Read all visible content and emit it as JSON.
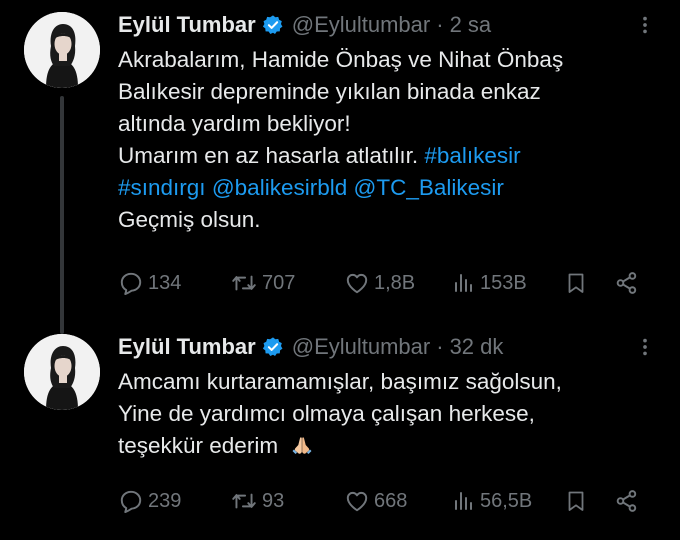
{
  "tweets": [
    {
      "author": {
        "name": "Eylül Tumbar",
        "handle": "@Eylultumbar",
        "verified": true
      },
      "separator": "·",
      "time": "2 sa",
      "text_lines": [
        [
          {
            "text": "Akrabalarım, Hamide Önbaş ve Nihat Önbaş",
            "link": false
          }
        ],
        [
          {
            "text": "Balıkesir depreminde yıkılan binada enkaz",
            "link": false
          }
        ],
        [
          {
            "text": "altında yardım bekliyor!",
            "link": false
          }
        ],
        [
          {
            "text": "Umarım en az hasarla atlatılır. ",
            "link": false
          },
          {
            "text": "#balıkesir",
            "link": true
          }
        ],
        [
          {
            "text": "#sındırgı",
            "link": true
          },
          {
            "text": " ",
            "link": false
          },
          {
            "text": "@balikesirbld",
            "link": true
          },
          {
            "text": " ",
            "link": false
          },
          {
            "text": "@TC_Balikesir",
            "link": true
          }
        ],
        [
          {
            "text": "Geçmiş olsun.",
            "link": false
          }
        ]
      ],
      "stats": {
        "replies": "134",
        "reposts": "707",
        "likes": "1,8B",
        "views": "153B"
      }
    },
    {
      "author": {
        "name": "Eylül Tumbar",
        "handle": "@Eylultumbar",
        "verified": true
      },
      "separator": "·",
      "time": "32 dk",
      "text_lines": [
        [
          {
            "text": "Amcamı kurtaramamışlar, başımız sağolsun,",
            "link": false
          }
        ],
        [
          {
            "text": "Yine de yardımcı olmaya çalışan herkese,",
            "link": false
          }
        ],
        [
          {
            "text": "teşekkür ederim",
            "link": false
          }
        ]
      ],
      "emoji": "folded-hands-emoji",
      "stats": {
        "replies": "239",
        "reposts": "93",
        "likes": "668",
        "views": "56,5B"
      }
    }
  ],
  "icons": {
    "verified": "verified-badge-icon",
    "more": "more-icon",
    "reply": "reply-icon",
    "repost": "repost-icon",
    "like": "like-icon",
    "views": "views-icon",
    "bookmark": "bookmark-icon",
    "share": "share-icon"
  },
  "colors": {
    "background": "#000000",
    "text": "#e7e9ea",
    "secondary": "#71767b",
    "link": "#1d9bf0",
    "verified": "#1d9bf0",
    "divider": "#2f3336"
  }
}
